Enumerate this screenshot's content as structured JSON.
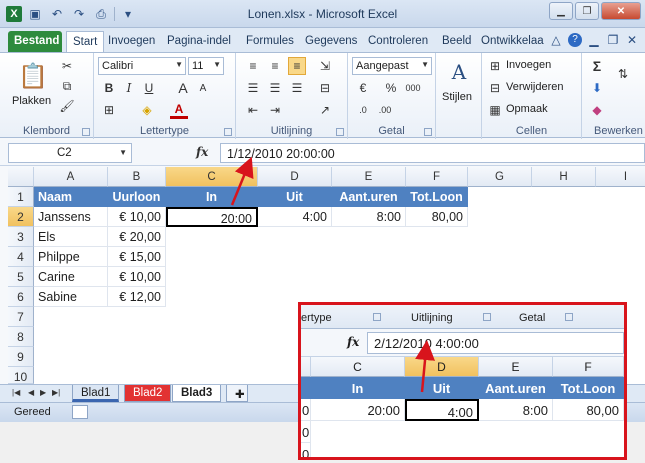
{
  "window": {
    "title": "Lonen.xlsx - Microsoft Excel",
    "app_icon": "X"
  },
  "tabs": {
    "file": "Bestand",
    "items": [
      "Start",
      "Invoegen",
      "Pagina-indel",
      "Formules",
      "Gegevens",
      "Controleren",
      "Beeld",
      "Ontwikkelaa"
    ],
    "active": "Start"
  },
  "ribbon": {
    "clipboard": {
      "label": "Klembord",
      "paste": "Plakken"
    },
    "font": {
      "label": "Lettertype",
      "name": "Calibri",
      "size": "11",
      "bold": "B",
      "italic": "I",
      "underline": "U",
      "grow": "A",
      "shrink": "A"
    },
    "alignment": {
      "label": "Uitlijning"
    },
    "number": {
      "label": "Getal",
      "format": "Aangepast",
      "percent": "%",
      "thousands": "000",
      "currency": "€"
    },
    "styles": {
      "label": "Stijlen"
    },
    "cells": {
      "label": "Cellen",
      "insert": "Invoegen",
      "delete": "Verwijderen",
      "format": "Opmaak"
    },
    "editing": {
      "label": "Bewerken",
      "sigma": "Σ"
    }
  },
  "formula_bar": {
    "name_box": "C2",
    "fx": "fx",
    "value": "1/12/2010  20:00:00"
  },
  "columns": [
    "A",
    "B",
    "C",
    "D",
    "E",
    "F",
    "G",
    "H",
    "I"
  ],
  "rows": [
    "1",
    "2",
    "3",
    "4",
    "5",
    "6",
    "7",
    "8",
    "9",
    "10"
  ],
  "table": {
    "headers": [
      "Naam",
      "Uurloon",
      "In",
      "Uit",
      "Aant.uren",
      "Tot.Loon"
    ],
    "data": [
      [
        "Janssens",
        "€ 10,00",
        "20:00",
        "4:00",
        "8:00",
        "80,00"
      ],
      [
        "Els",
        "€ 20,00",
        "",
        "",
        "",
        ""
      ],
      [
        "Philppe",
        "€ 15,00",
        "",
        "",
        "",
        ""
      ],
      [
        "Carine",
        "€ 10,00",
        "",
        "",
        "",
        ""
      ],
      [
        "Sabine",
        "€ 12,00",
        "",
        "",
        "",
        ""
      ]
    ]
  },
  "sheets": {
    "items": [
      "Blad1",
      "Blad2",
      "Blad3"
    ],
    "active": "Blad3"
  },
  "status": {
    "text": "Gereed"
  },
  "inset": {
    "ribbon_labels": [
      "ertype",
      "Uitlijning",
      "Getal"
    ],
    "fx": "fx",
    "formula": "2/12/2010  4:00:00",
    "columns": [
      "C",
      "D",
      "E",
      "F"
    ],
    "headers": [
      "In",
      "Uit",
      "Aant.uren",
      "Tot.Loon"
    ],
    "row": [
      "20:00",
      "4:00",
      "8:00",
      "80,00"
    ],
    "left_stub": "0",
    "left_stub_rows": [
      "0",
      "0"
    ]
  },
  "colors": {
    "accent": "#4f81c1",
    "highlight": "#d8141c",
    "file_tab": "#2e8b3d"
  }
}
